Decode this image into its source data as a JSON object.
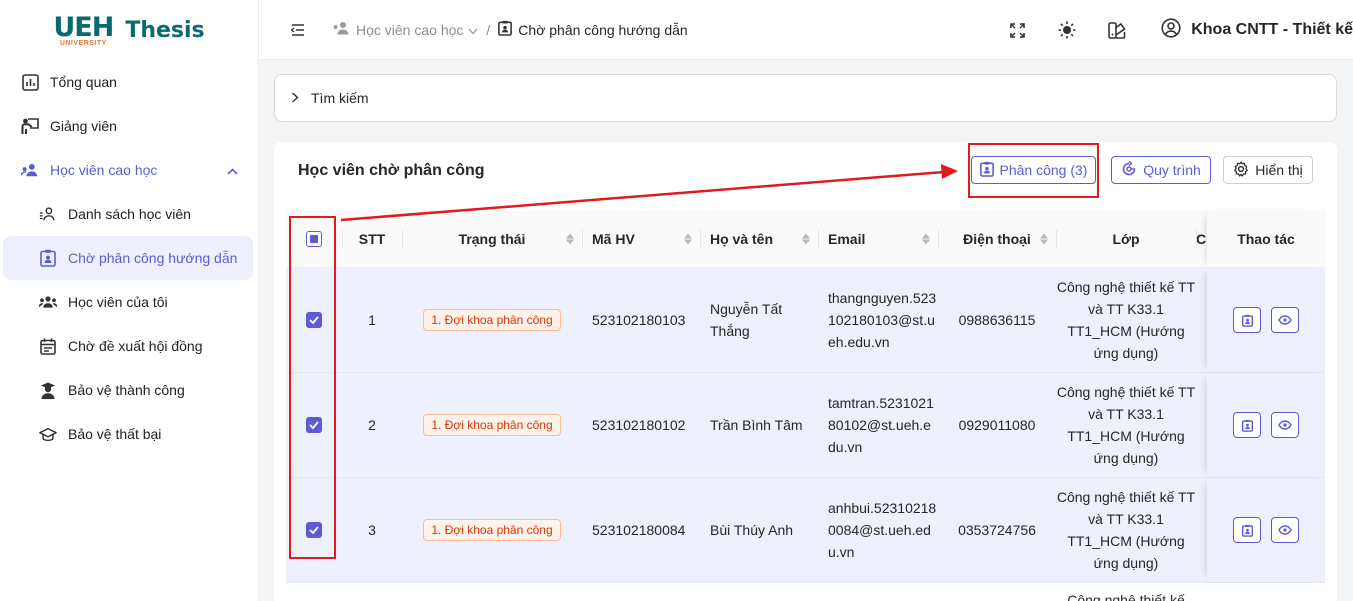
{
  "app": {
    "logo_text": "UEH",
    "logo_sub": "UNIVERSITY",
    "name": "Thesis"
  },
  "sidebar": {
    "items": [
      {
        "label": "Tổng quan",
        "icon": "dashboard-icon"
      },
      {
        "label": "Giảng viên",
        "icon": "teacher-icon"
      },
      {
        "label": "Học viên cao học",
        "icon": "students-group-icon",
        "expanded": true
      },
      {
        "label": "Danh sách học viên",
        "icon": "student-list-icon"
      },
      {
        "label": "Chờ phân công hướng dẫn",
        "icon": "clipboard-user-icon",
        "active": true
      },
      {
        "label": "Học viên của tôi",
        "icon": "users-icon"
      },
      {
        "label": "Chờ đề xuất hội đồng",
        "icon": "calendar-icon"
      },
      {
        "label": "Bảo vệ thành công",
        "icon": "graduate-icon"
      },
      {
        "label": "Bảo vệ thất bại",
        "icon": "cap-icon"
      }
    ]
  },
  "header": {
    "breadcrumb_parent": "Học viên cao học",
    "breadcrumb_current": "Chờ phân công hướng dẫn",
    "user_name": "Khoa CNTT - Thiết kế"
  },
  "search": {
    "label": "Tìm kiếm"
  },
  "card": {
    "title": "Học viên chờ phân công",
    "btn_assign": "Phân công (3)",
    "btn_process": "Quy trình",
    "btn_display": "Hiển thị"
  },
  "table": {
    "columns": {
      "stt": "STT",
      "status": "Trạng thái",
      "mahv": "Mã HV",
      "name": "Họ và tên",
      "email": "Email",
      "phone": "Điện thoại",
      "lop": "Lớp",
      "more": "C",
      "actions": "Thao tác"
    },
    "rows": [
      {
        "stt": "1",
        "status": "1. Đợi khoa phân công",
        "mahv": "523102180103",
        "name": "Nguyễn Tất Thắng",
        "email": "thangnguyen.523102180103@st.ueh.edu.vn",
        "phone": "0988636115",
        "lop": "Công nghệ thiết kế TT và TT K33.1 TT1_HCM (Hướng ứng dụng)",
        "checked": true
      },
      {
        "stt": "2",
        "status": "1. Đợi khoa phân công",
        "mahv": "523102180102",
        "name": "Trần Bình Tâm",
        "email": "tamtran.523102180102@st.ueh.edu.vn",
        "phone": "0929011080",
        "lop": "Công nghệ thiết kế TT và TT K33.1 TT1_HCM (Hướng ứng dụng)",
        "checked": true
      },
      {
        "stt": "3",
        "status": "1. Đợi khoa phân công",
        "mahv": "523102180084",
        "name": "Bùi Thúy Anh",
        "email": "anhbui.523102180084@st.ueh.edu.vn",
        "phone": "0353724756",
        "lop": "Công nghệ thiết kế TT và TT K33.1 TT1_HCM (Hướng ứng dụng)",
        "checked": true
      },
      {
        "stt": "",
        "status": "",
        "mahv": "",
        "name": "",
        "email": "",
        "phone": "",
        "lop": "Công nghệ thiết kế",
        "checked": false
      }
    ]
  },
  "colors": {
    "accent": "#5b5bd6",
    "annotation": "#e01b1b",
    "tag_text": "#d4380d",
    "brand": "#0b6a6f"
  }
}
